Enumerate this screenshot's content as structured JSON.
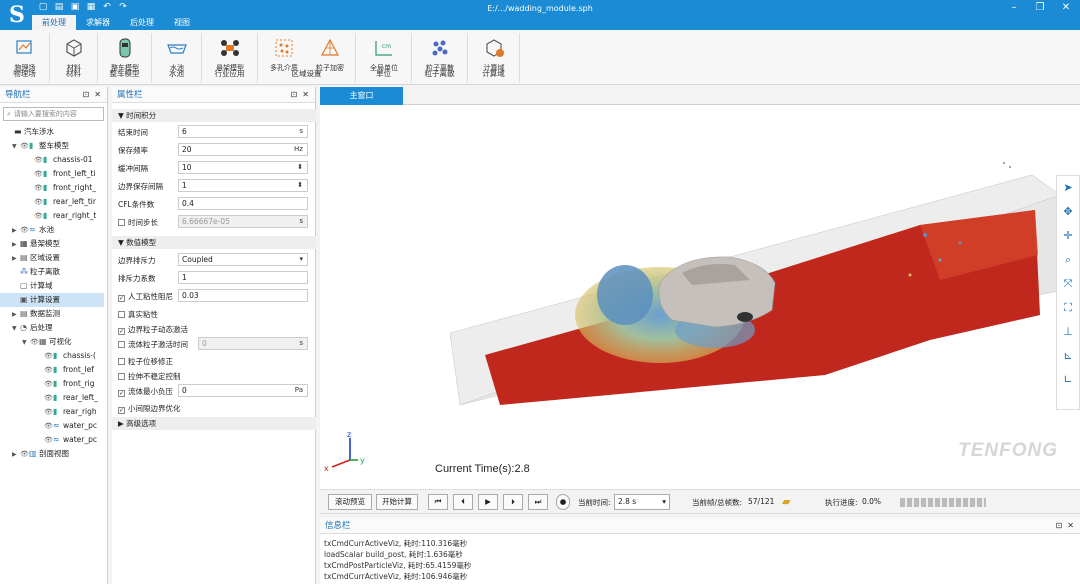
{
  "app": {
    "window_title": "E:/.../wadding_module.sph"
  },
  "menu_tabs": [
    "前处理",
    "求解器",
    "后处理",
    "视图"
  ],
  "ribbon": {
    "groups": [
      {
        "label": "物理场",
        "buttons": [
          "物理场"
        ]
      },
      {
        "label": "材料",
        "buttons": [
          "材料"
        ]
      },
      {
        "label": "整车模型",
        "buttons": [
          "整车模型"
        ]
      },
      {
        "label": "水池",
        "buttons": [
          "水池"
        ]
      },
      {
        "label": "行业应用",
        "buttons": [
          "悬架模型"
        ]
      },
      {
        "label": "区域设置",
        "buttons": [
          "多孔介质",
          "粒子加密"
        ]
      },
      {
        "label": "单位",
        "buttons": [
          "全局单位"
        ]
      },
      {
        "label": "粒子离散",
        "buttons": [
          "粒子离散"
        ]
      },
      {
        "label": "计算域",
        "buttons": [
          "计算域"
        ]
      }
    ]
  },
  "nav": {
    "title": "导航栏",
    "search_placeholder": "请输入要搜索的内容",
    "items": [
      {
        "label": "汽车涉水",
        "level": 0
      },
      {
        "label": "整车模型",
        "level": 0
      },
      {
        "label": "chassis-01",
        "level": 1
      },
      {
        "label": "front_left_ti",
        "level": 1
      },
      {
        "label": "front_right_",
        "level": 1
      },
      {
        "label": "rear_left_tir",
        "level": 1
      },
      {
        "label": "rear_right_t",
        "level": 1
      },
      {
        "label": "水池",
        "level": 0
      },
      {
        "label": "悬架模型",
        "level": 0
      },
      {
        "label": "区域设置",
        "level": 0
      },
      {
        "label": "粒子离散",
        "level": 0
      },
      {
        "label": "计算域",
        "level": 0
      },
      {
        "label": "计算设置",
        "level": 0
      },
      {
        "label": "数据监测",
        "level": 0
      },
      {
        "label": "后处理",
        "level": 0
      },
      {
        "label": "可视化",
        "level": 1
      },
      {
        "label": "chassis-(",
        "level": 2
      },
      {
        "label": "front_lef",
        "level": 2
      },
      {
        "label": "front_rig",
        "level": 2
      },
      {
        "label": "rear_left_",
        "level": 2
      },
      {
        "label": "rear_righ",
        "level": 2
      },
      {
        "label": "water_pc",
        "level": 2
      },
      {
        "label": "water_pc",
        "level": 2
      },
      {
        "label": "剖面视图",
        "level": 0
      }
    ]
  },
  "props": {
    "title": "属性栏",
    "sections": {
      "time": "时间积分",
      "model": "数值模型",
      "advanced": "高级选项"
    },
    "time_rows": [
      {
        "label": "结束时间",
        "value": "6",
        "unit": "s"
      },
      {
        "label": "保存频率",
        "value": "20",
        "unit": "Hz"
      },
      {
        "label": "缓冲间隔",
        "value": "10",
        "unit": ""
      },
      {
        "label": "边界保存间隔",
        "value": "1",
        "unit": ""
      },
      {
        "label": "CFL条件数",
        "value": "0.4",
        "unit": ""
      },
      {
        "label": "时间步长",
        "value": "6.66667e-05",
        "unit": "s"
      }
    ],
    "model_rows": [
      {
        "label": "边界排斥力",
        "value": "Coupled",
        "unit": ""
      },
      {
        "label": "排斥力系数",
        "value": "1",
        "unit": ""
      },
      {
        "label": "人工粘性阻尼",
        "value": "0.03",
        "unit": ""
      },
      {
        "label": "真实粘性",
        "value": "",
        "unit": ""
      },
      {
        "label": "边界粒子动态激活",
        "value": "",
        "unit": ""
      },
      {
        "label": "流体粒子激活时间",
        "value": "0",
        "unit": "s"
      },
      {
        "label": "粒子位移修正",
        "value": "",
        "unit": ""
      },
      {
        "label": "拉伸不稳定控制",
        "value": "",
        "unit": ""
      },
      {
        "label": "流体最小负压",
        "value": "0",
        "unit": "Pa"
      },
      {
        "label": "小间隙边界优化",
        "value": "",
        "unit": ""
      }
    ]
  },
  "viewport": {
    "tab": "主窗口",
    "current_time": "Current Time(s):2.8",
    "brand": "TENFONG",
    "axes": {
      "x": "x",
      "y": "y",
      "z": "z"
    }
  },
  "playbar": {
    "preview_btn": "滚动预览",
    "start_btn": "开始计算",
    "time_label": "当前时间:",
    "time_value": "2.8 s",
    "frames_label": "当前帧/总帧数:",
    "frames_value": "57/121",
    "progress_label": "执行进度:",
    "progress_value": "0.0%"
  },
  "info": {
    "title": "信息栏",
    "lines": [
      "txCmdCurrActiveViz, 耗时:110.316毫秒",
      "loadScalar build_post, 耗时:1.636毫秒",
      "txCmdPostParticleViz, 耗时:65.4159毫秒",
      "txCmdCurrActiveViz, 耗时:106.946毫秒"
    ]
  },
  "colors": {
    "accent": "#1a8bd4",
    "water_red": "#c0281e",
    "water_blue": "#5b8fc0"
  }
}
